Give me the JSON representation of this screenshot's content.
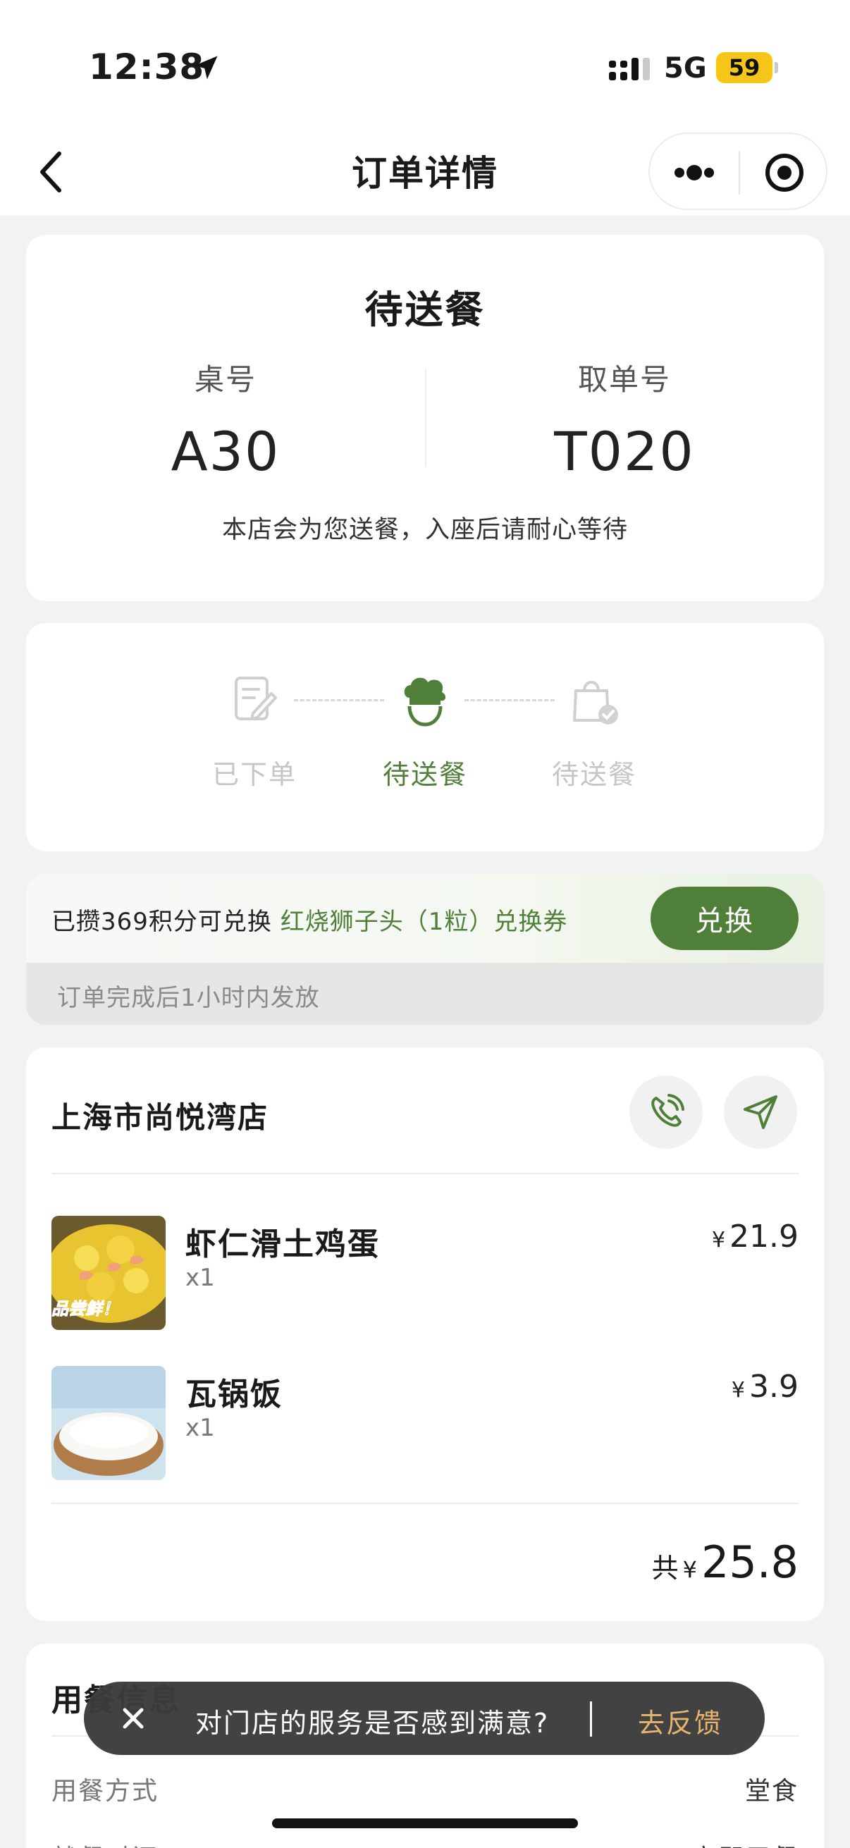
{
  "status_bar": {
    "time": "12:38",
    "network": "5G",
    "battery": "59"
  },
  "nav": {
    "title": "订单详情"
  },
  "order_status": {
    "title": "待送餐",
    "table_label": "桌号",
    "table_value": "A30",
    "pickup_label": "取单号",
    "pickup_value": "T020",
    "notice": "本店会为您送餐，入座后请耐心等待"
  },
  "progress": {
    "steps": [
      {
        "label": "已下单",
        "state": "inactive",
        "icon": "order-note-icon"
      },
      {
        "label": "待送餐",
        "state": "active",
        "icon": "chef-hat-icon"
      },
      {
        "label": "待送餐",
        "state": "inactive",
        "icon": "bag-check-icon"
      }
    ],
    "active_color": "#4f7f39",
    "inactive_color": "#c6c6c6"
  },
  "points": {
    "text_prefix": "已攒369积分可兑换",
    "highlight": "红烧狮子头（1粒）兑换券",
    "button_label": "兑换",
    "note": "订单完成后1小时内发放"
  },
  "store": {
    "name": "上海市尚悦湾店",
    "phone_icon": "phone-icon",
    "navigate_icon": "navigation-arrow-icon",
    "items": [
      {
        "name": "虾仁滑土鸡蛋",
        "qty": "x1",
        "currency": "¥",
        "price": "21.9",
        "image_text": "品尝鲜！"
      },
      {
        "name": "瓦锅饭",
        "qty": "x1",
        "currency": "¥",
        "price": "3.9"
      }
    ],
    "total_label": "共",
    "total_currency": "¥",
    "total_value": "25.8"
  },
  "dining_info": {
    "title": "用餐信息",
    "rows": [
      {
        "label": "用餐方式",
        "value": "堂食"
      },
      {
        "label": "就餐时间",
        "value": "立即用餐"
      }
    ]
  },
  "toast": {
    "text": "对门店的服务是否感到满意?",
    "action": "去反馈"
  },
  "colors": {
    "brand_green": "#4f7f39",
    "toast_action": "#e7b46e",
    "battery": "#f5c518"
  }
}
